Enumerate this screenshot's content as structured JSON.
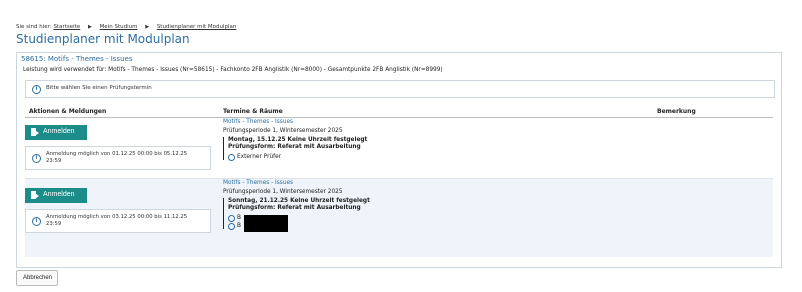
{
  "breadcrumb": {
    "prefix": "Sie sind hier:",
    "items": [
      "Startseite",
      "Mein Studium",
      "Studienplaner mit Modulplan"
    ],
    "separator": "▶"
  },
  "page_title": "Studienplaner mit Modulplan",
  "module": {
    "heading": "58615: Motifs - Themes - Issues",
    "usage": "Leistung wird verwendet für: Motifs - Themes - Issues (Nr=58615) - Fachkonto 2FB Anglistik (Nr=8000) - Gesamtpunkte 2FB Anglistik (Nr=8999)"
  },
  "info": {
    "text": "Bitte wählen Sie einen Prüfungstermin",
    "icon": "info-icon"
  },
  "table": {
    "columns": [
      "Aktionen & Meldungen",
      "Termine & Räume",
      "Bemerkung"
    ],
    "rows": [
      {
        "button": "Anmelden",
        "notice": "Anmeldung möglich von 01.12.25 00:00 bis 05.12.25 23:59",
        "link": "Motifs - Themes - Issues",
        "period": "Prüfungsperiode 1, Wintersemester 2025",
        "date": "Montag, 15.12.25 Keine Uhrzeit festgelegt",
        "form": "Prüfungsform: Referat mit Ausarbeitung",
        "persons": [
          "Externer Prüfer"
        ],
        "remark": ""
      },
      {
        "button": "Anmelden",
        "notice": "Anmeldung möglich von 03.12.25 00:00 bis 11.12.25 23:59",
        "link": "Motifs - Themes - Issues",
        "period": "Prüfungsperiode 1, Wintersemester 2025",
        "date": "Sonntag, 21.12.25 Keine Uhrzeit festgelegt",
        "form": "Prüfungsform: Referat mit Ausarbeitung",
        "persons": [
          "B",
          "B"
        ],
        "remark": ""
      }
    ]
  },
  "cancel_button": "Abbrechen",
  "colors": {
    "accent": "#2d6ea1",
    "button": "#1b8c88",
    "row_highlight": "#eef4f9"
  }
}
